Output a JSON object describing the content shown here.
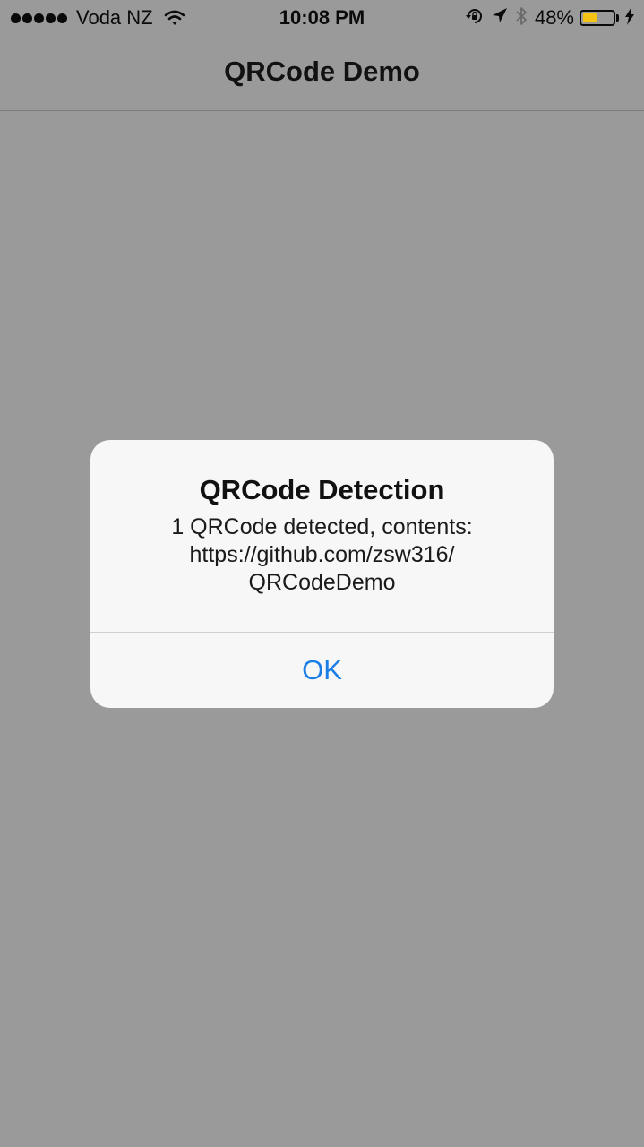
{
  "status_bar": {
    "carrier": "Voda NZ",
    "time": "10:08 PM",
    "battery_percent": "48%",
    "battery_level": 0.48,
    "signal_bars": 5,
    "icons": [
      "wifi-icon",
      "orientation-lock-icon",
      "location-icon",
      "bluetooth-icon",
      "battery-icon",
      "charging-bolt-icon"
    ],
    "battery_color": "#f4c313"
  },
  "nav_bar": {
    "title": "QRCode Demo"
  },
  "alert": {
    "title": "QRCode Detection",
    "message_lines": [
      "1 QRCode detected, contents:",
      "https://github.com/zsw316/",
      "QRCodeDemo"
    ],
    "ok_label": "OK",
    "accent_color": "#1a7ee6"
  }
}
